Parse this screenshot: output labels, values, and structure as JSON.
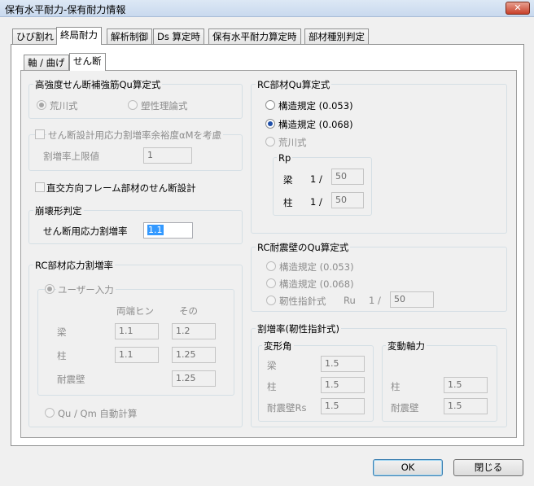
{
  "window": {
    "title": "保有水平耐力-保有耐力情報",
    "close_glyph": "✕"
  },
  "tabs": [
    "ひび割れ",
    "終局耐力",
    "解析制御",
    "Ds 算定時",
    "保有水平耐力算定時",
    "部材種別判定"
  ],
  "subtabs": [
    "軸 / 曲げ",
    "せん断"
  ],
  "left": {
    "high_strength": {
      "title": "高強度せん断補強筋Qu算定式",
      "options": [
        "荒川式",
        "塑性理論式"
      ],
      "selected": "荒川式"
    },
    "alpha_m": {
      "label": "せん断設計用応力割増率余裕度αMを考慮",
      "limit_label": "割増率上限値",
      "limit_value": "1"
    },
    "ortho_label": "直交方向フレーム部材のせん断設計",
    "collapse": {
      "title": "崩壊形判定",
      "label": "せん断用応力割増率",
      "value": "1.1"
    },
    "rc_ratio": {
      "title": "RC部材応力割増率",
      "user_input": "ユーザー入力",
      "col_headers": [
        "両端ヒン",
        "その"
      ],
      "rows": [
        {
          "label": "梁",
          "v1": "1.1",
          "v2": "1.2"
        },
        {
          "label": "柱",
          "v1": "1.1",
          "v2": "1.25"
        },
        {
          "label": "耐震壁",
          "v2": "1.25"
        }
      ],
      "auto_label": "Qu / Qm 自動計算"
    }
  },
  "right": {
    "rc_qu": {
      "title": "RC部材Qu算定式",
      "options": [
        "構造規定 (0.053)",
        "構造規定 (0.068)",
        "荒川式"
      ],
      "selected": "構造規定 (0.068)",
      "rp": {
        "title": "Rp",
        "rows": [
          {
            "label": "梁",
            "prefix": "1 /",
            "value": "50"
          },
          {
            "label": "柱",
            "prefix": "1 /",
            "value": "50"
          }
        ]
      }
    },
    "wall_qu": {
      "title": "RC耐震壁のQu算定式",
      "options": [
        "構造規定 (0.053)",
        "構造規定 (0.068)",
        "靭性指針式"
      ],
      "ru_label": "Ru",
      "ru_prefix": "1 /",
      "ru_value": "50"
    },
    "ratio": {
      "title": "割増率(靭性指針式)",
      "deform": {
        "title": "変形角",
        "rows": [
          {
            "label": "梁",
            "value": "1.5"
          },
          {
            "label": "柱",
            "value": "1.5"
          },
          {
            "label": "耐震壁Rs",
            "value": "1.5"
          }
        ]
      },
      "axial": {
        "title": "変動軸力",
        "rows": [
          {
            "label": "柱",
            "value": "1.5"
          },
          {
            "label": "耐震壁",
            "value": "1.5"
          }
        ]
      }
    }
  },
  "buttons": {
    "ok": "OK",
    "close": "閉じる"
  }
}
